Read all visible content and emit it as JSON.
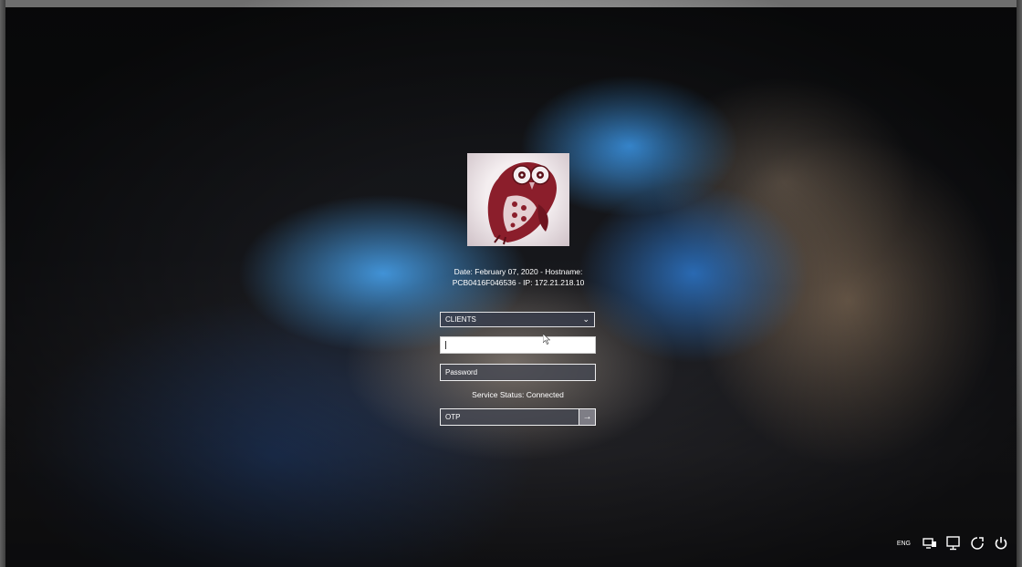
{
  "login": {
    "info_line1": "Date: February 07, 2020 - Hostname:",
    "info_line2": "PCB0416F046536 - IP: 172.21.218.10",
    "domain_selected": "CLIENTS",
    "username_value": "",
    "password_placeholder": "Password",
    "service_status": "Service Status: Connected",
    "otp_placeholder": "OTP"
  },
  "tray": {
    "language": "ENG",
    "icons": [
      "network-icon",
      "display-icon",
      "accessibility-icon",
      "power-icon"
    ]
  },
  "colors": {
    "field_border": "#ffffff",
    "field_dark_bg": "#464852",
    "logo_owl": "#8b1e2b"
  }
}
